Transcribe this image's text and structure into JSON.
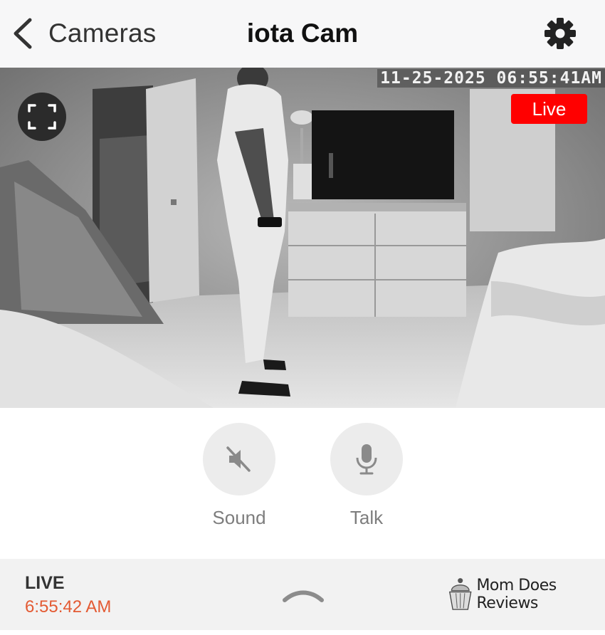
{
  "header": {
    "back_label": "Cameras",
    "title": "iota Cam",
    "settings_icon": "gear-icon"
  },
  "feed": {
    "timestamp": "11-25-2025 06:55:41AM",
    "live_badge": "Live",
    "live_badge_color": "#ff0000",
    "fullscreen_icon": "fullscreen-icon"
  },
  "controls": {
    "sound_label": "Sound",
    "sound_icon": "speaker-muted-icon",
    "talk_label": "Talk",
    "talk_icon": "microphone-icon"
  },
  "status": {
    "live_label": "LIVE",
    "live_time": "6:55:42 AM",
    "live_time_color": "#e35a33",
    "expand_icon": "chevron-up-icon"
  },
  "watermark": {
    "text": "Mom Does Reviews"
  }
}
